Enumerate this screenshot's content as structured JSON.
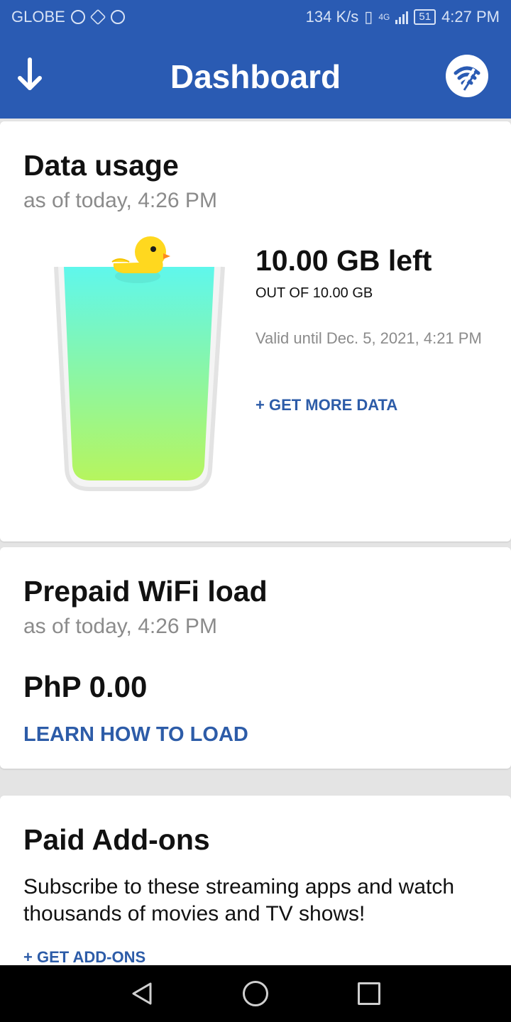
{
  "status_bar": {
    "carrier": "GLOBE",
    "net_speed": "134 K/s",
    "network_type": "4G",
    "battery": "51",
    "time": "4:27 PM"
  },
  "app_bar": {
    "title": "Dashboard",
    "left_icon": "download-arrow-icon",
    "right_icon": "wifi-fast-icon"
  },
  "data_usage": {
    "title": "Data usage",
    "as_of": "as of today, 4:26 PM",
    "left": "10.00 GB left",
    "total": "OUT OF 10.00 GB",
    "valid_until": "Valid until Dec. 5, 2021, 4:21 PM",
    "get_more": "+ GET MORE DATA",
    "fill_fraction": 1.0
  },
  "wifi_load": {
    "title": "Prepaid WiFi load",
    "as_of": "as of today, 4:26 PM",
    "amount": "PhP 0.00",
    "learn": "LEARN HOW TO LOAD"
  },
  "addons": {
    "title": "Paid Add-ons",
    "description": "Subscribe to these streaming apps and watch thousands of movies and TV shows!",
    "get_addons": "+ GET ADD-ONS"
  },
  "colors": {
    "brand_blue": "#2a5bb3",
    "link_blue": "#2d5ca8",
    "glass_top": "#5ff7ec",
    "glass_bottom": "#b6f55e",
    "duck_yellow": "#ffd81f"
  }
}
